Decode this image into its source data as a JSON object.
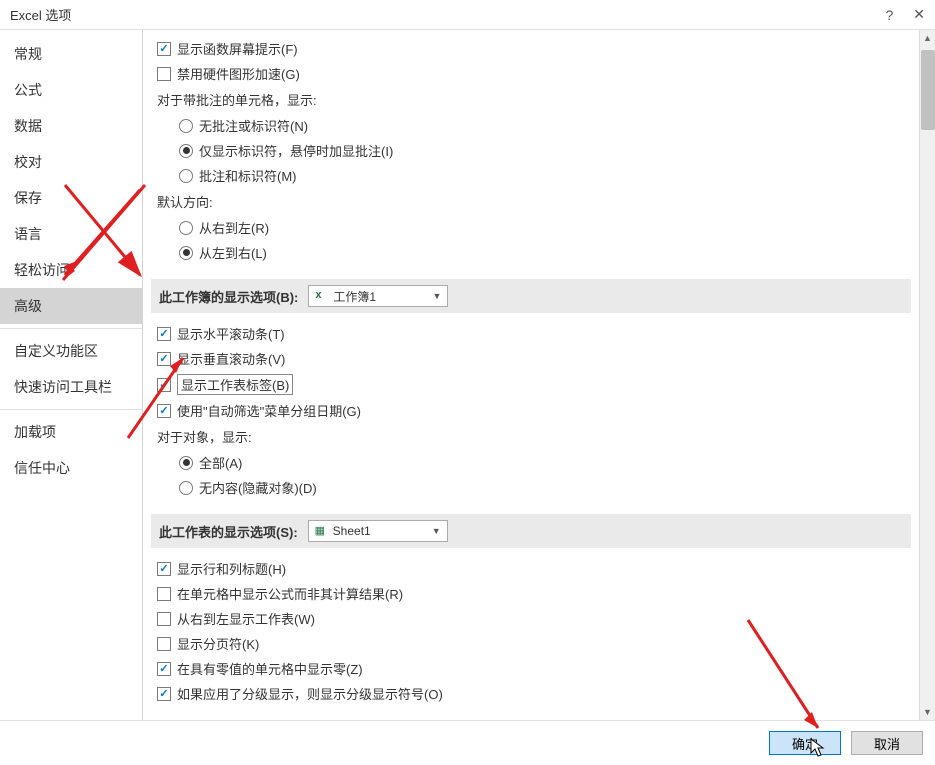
{
  "window": {
    "title": "Excel 选项"
  },
  "sidebar": {
    "items": [
      {
        "label": "常规"
      },
      {
        "label": "公式"
      },
      {
        "label": "数据"
      },
      {
        "label": "校对"
      },
      {
        "label": "保存"
      },
      {
        "label": "语言"
      },
      {
        "label": "轻松访问"
      },
      {
        "label": "高级",
        "active": true
      }
    ],
    "items2": [
      {
        "label": "自定义功能区"
      },
      {
        "label": "快速访问工具栏"
      }
    ],
    "items3": [
      {
        "label": "加载项"
      },
      {
        "label": "信任中心"
      }
    ]
  },
  "options": {
    "show_func_tips": "显示函数屏幕提示(F)",
    "disable_hw_accel": "禁用硬件图形加速(G)",
    "comment_cells_label": "对于带批注的单元格，显示:",
    "comment_none": "无批注或标识符(N)",
    "comment_indicator": "仅显示标识符，悬停时加显批注(I)",
    "comment_both": "批注和标识符(M)",
    "default_dir_label": "默认方向:",
    "dir_rtl": "从右到左(R)",
    "dir_ltr": "从左到右(L)",
    "workbook_header": "此工作簿的显示选项(B):",
    "workbook_dropdown": "工作簿1",
    "show_hscroll": "显示水平滚动条(T)",
    "show_vscroll": "显示垂直滚动条(V)",
    "show_sheet_tabs": "显示工作表标签(B)",
    "autofilter_group": "使用\"自动筛选\"菜单分组日期(G)",
    "objects_label": "对于对象，显示:",
    "obj_all": "全部(A)",
    "obj_none": "无内容(隐藏对象)(D)",
    "worksheet_header": "此工作表的显示选项(S):",
    "worksheet_dropdown": "Sheet1",
    "show_headers": "显示行和列标题(H)",
    "show_formulas": "在单元格中显示公式而非其计算结果(R)",
    "show_rtl_sheet": "从右到左显示工作表(W)",
    "show_page_breaks": "显示分页符(K)",
    "show_zeros": "在具有零值的单元格中显示零(Z)",
    "show_outline": "如果应用了分级显示，则显示分级显示符号(O)"
  },
  "footer": {
    "ok": "确定",
    "cancel": "取消"
  }
}
